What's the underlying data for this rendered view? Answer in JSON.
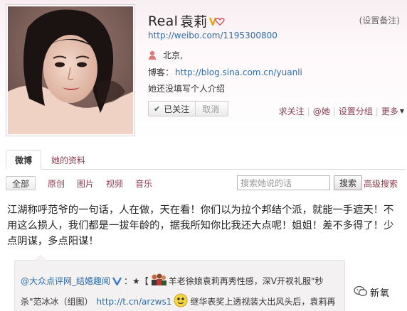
{
  "profile": {
    "name_latin": "Real",
    "name_cjk": "袁莉",
    "set_remark": "(设置备注)",
    "url": "http://weibo.com/1195300800",
    "location": "北京,",
    "blog_label": "博客：",
    "blog_url": "http://blog.sina.com.cn/yuanli",
    "intro": "她还没填写个人介绍",
    "follow_status": "已关注",
    "cancel_follow": "取消",
    "actions": {
      "ask_follow": "求关注",
      "mention": "@她",
      "set_group": "设置分组",
      "more": "更多"
    },
    "colors": {
      "link": "#2e6ca9",
      "accent": "#8a3b4e"
    }
  },
  "tabs": [
    {
      "label": "微博"
    },
    {
      "label": "她的资料"
    }
  ],
  "filters": {
    "all": "全部",
    "items": [
      "原创",
      "图片",
      "视频",
      "音乐"
    ],
    "search_placeholder": "搜索她说的话",
    "search_button": "搜索",
    "advanced_search": "高级搜索"
  },
  "post": {
    "text": "江湖称呼范爷的一句话，人在做，天在看！你们以为拉个邦结个派，就能一手遮天！不用这么损人，我们都是一拔年龄的，据我所知你比我还大点呢！姐姐！差不多得了！少点阴谋，多点阳谋！"
  },
  "repost": {
    "author": "@大众点评网_结婚趣闻",
    "colon": "：★【",
    "line1_text": "羊老徐娘袁莉再秀性感，深V开衩礼服\"秒",
    "line2_text": "杀\"范冰冰（组图）",
    "line2_link": "http://t.cn/arzws1",
    "line2_text_after": "继华表奖上透视装大出风头后，袁莉再"
  },
  "watermark": {
    "text": "新氧"
  }
}
